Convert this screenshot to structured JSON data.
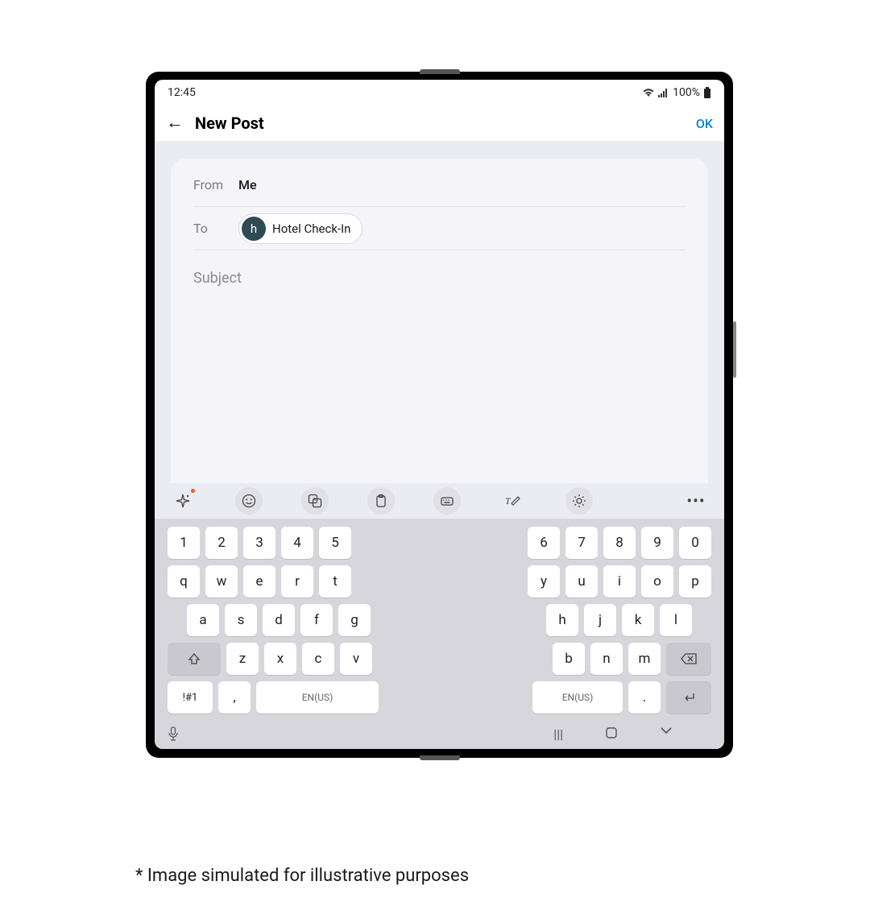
{
  "status": {
    "time": "12:45",
    "battery": "100%"
  },
  "header": {
    "title": "New Post",
    "ok": "OK"
  },
  "compose": {
    "from_label": "From",
    "from_value": "Me",
    "to_label": "To",
    "to_chip_initial": "h",
    "to_chip_label": "Hotel Check-In",
    "subject_placeholder": "Subject"
  },
  "kb": {
    "row1": [
      "1",
      "2",
      "3",
      "4",
      "5",
      "6",
      "7",
      "8",
      "9",
      "0"
    ],
    "row2": [
      "q",
      "w",
      "e",
      "r",
      "t",
      "y",
      "u",
      "i",
      "o",
      "p"
    ],
    "row3": [
      "a",
      "s",
      "d",
      "f",
      "g",
      "h",
      "j",
      "k",
      "l"
    ],
    "row4": [
      "z",
      "x",
      "c",
      "v",
      "b",
      "n",
      "m"
    ],
    "sym": "!#1",
    "comma": ",",
    "period": ".",
    "lang": "EN(US)"
  },
  "caption": "* Image simulated for illustrative purposes"
}
